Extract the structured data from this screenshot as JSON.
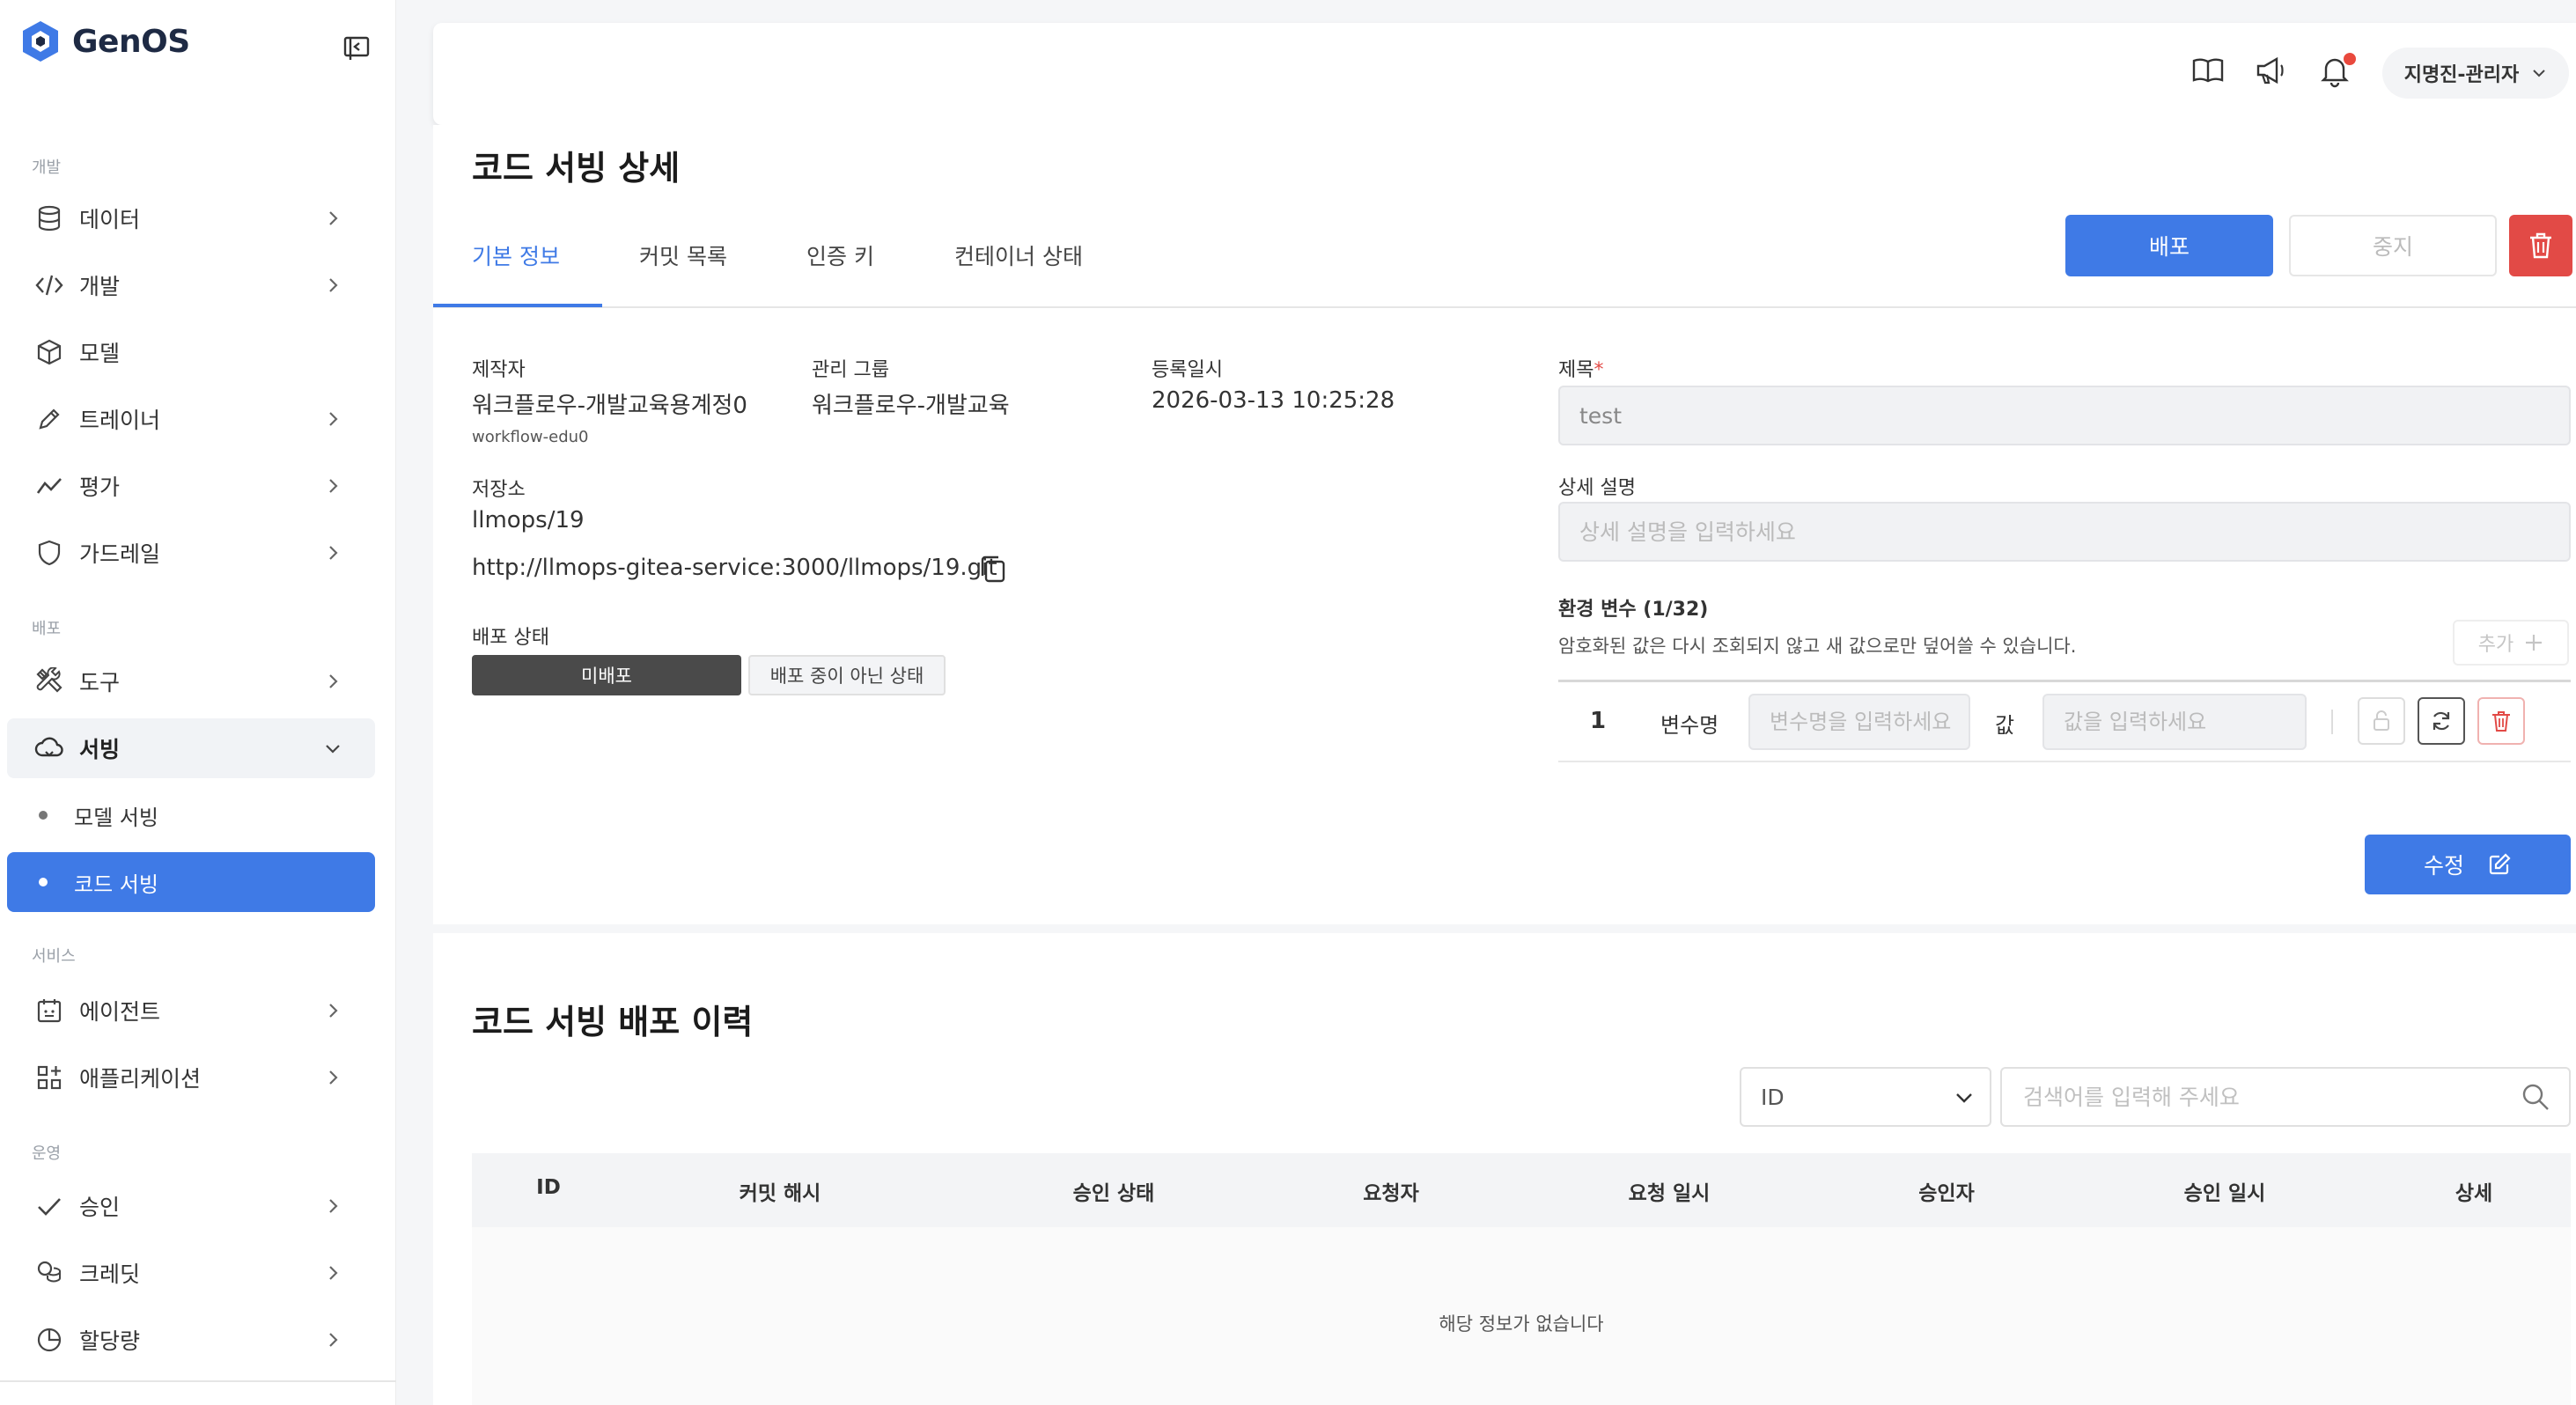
{
  "app": {
    "name": "GenOS"
  },
  "sidebar": {
    "sections": {
      "dev": "개발",
      "deploy": "배포",
      "service": "서비스",
      "ops": "운영"
    },
    "items": {
      "data": "데이터",
      "develop": "개발",
      "model": "모델",
      "trainer": "트레이너",
      "eval": "평가",
      "guardrail": "가드레일",
      "tools": "도구",
      "serving": "서빙",
      "agent": "에이전트",
      "application": "애플리케이션",
      "approval": "승인",
      "credit": "크레딧",
      "quota": "할당량"
    },
    "sub": {
      "model_serving": "모델 서빙",
      "code_serving": "코드 서빙"
    }
  },
  "header": {
    "user": "지명진-관리자"
  },
  "page": {
    "title": "코드 서빙 상세",
    "tabs": [
      "기본 정보",
      "커밋 목록",
      "인증 키",
      "컨테이너 상태"
    ],
    "actions": {
      "deploy": "배포",
      "stop": "중지"
    }
  },
  "info": {
    "creator_label": "제작자",
    "creator": "워크플로우-개발교육용계정0",
    "creator_id": "workflow-edu0",
    "group_label": "관리 그룹",
    "group": "워크플로우-개발교육",
    "date_label": "등록일시",
    "date": "2026-03-13 10:25:28",
    "repo_label": "저장소",
    "repo": "llmops/19",
    "repo_url": "http://llmops-gitea-service:3000/llmops/19.git",
    "status_label": "배포 상태",
    "status": "미배포",
    "status_desc": "배포 중이 아닌 상태"
  },
  "form": {
    "title_label": "제목",
    "title_required": "*",
    "title_value": "test",
    "desc_label": "상세 설명",
    "desc_placeholder": "상세 설명을 입력하세요",
    "env_label": "환경 변수 (1/32)",
    "env_hint": "암호화된 값은 다시 조회되지 않고 새 값으로만 덮어쓸 수 있습니다.",
    "add_label": "추가",
    "env_index": "1",
    "var_name_label": "변수명",
    "var_name_placeholder": "변수명을 입력하세요",
    "value_label": "값",
    "value_placeholder": "값을 입력하세요",
    "edit_label": "수정"
  },
  "history": {
    "title": "코드 서빙 배포 이력",
    "filter_value": "ID",
    "search_placeholder": "검색어를 입력해 주세요",
    "columns": [
      "ID",
      "커밋 해시",
      "승인 상태",
      "요청자",
      "요청 일시",
      "승인자",
      "승인 일시",
      "상세"
    ],
    "empty": "해당 정보가 없습니다"
  },
  "colors": {
    "primary": "#3f7ae6",
    "danger": "#e24a46",
    "status": "#4a4a4a"
  }
}
